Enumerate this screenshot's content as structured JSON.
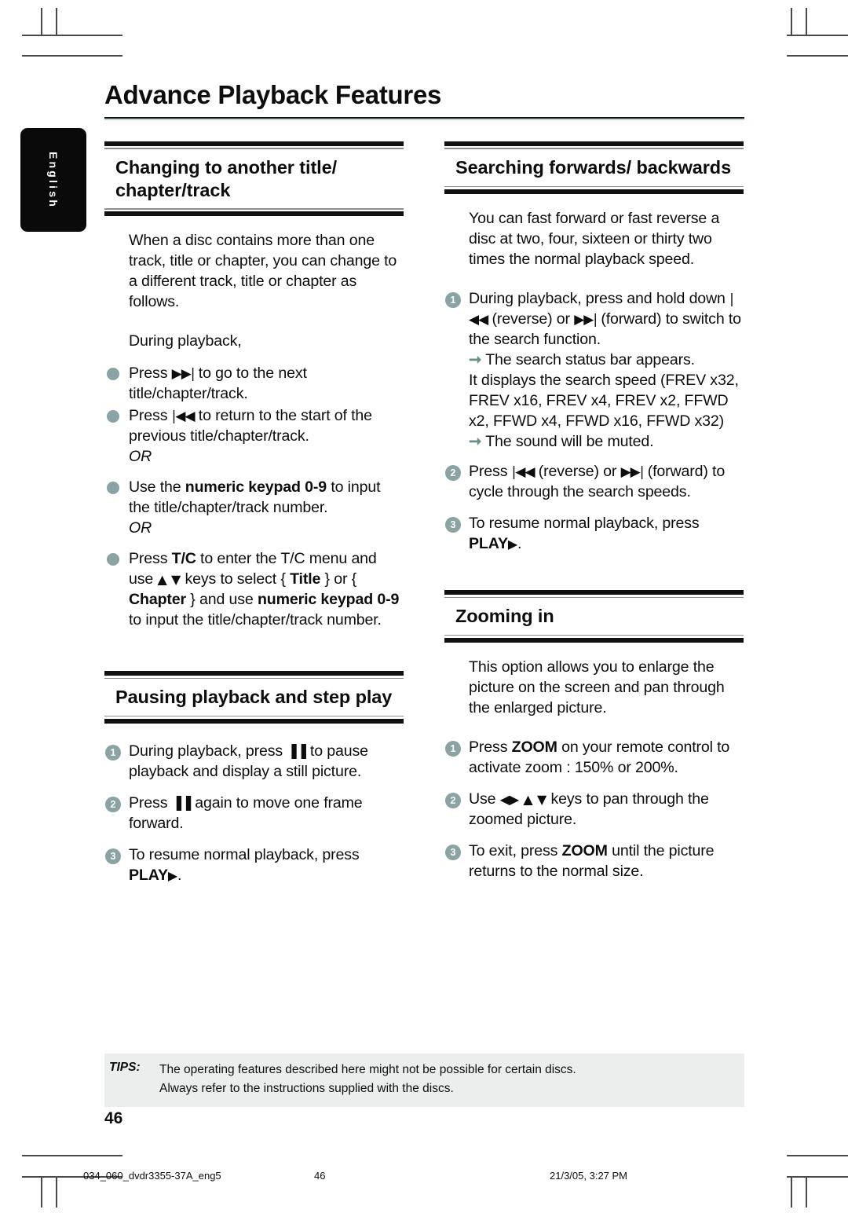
{
  "page_title": "Advance Playback Features",
  "language_tab": "English",
  "left_column": {
    "section1": {
      "heading": "Changing to another title/ chapter/track",
      "intro": "When a disc contains more than one track, title or chapter, you can change to a different track, title or chapter as follows.",
      "lead": "During playback,",
      "bullets": [
        {
          "text_before": "Press ",
          "glyph": "▶▶|",
          "text_after": " to go to the next title/chapter/track."
        },
        {
          "text_before": "Press ",
          "glyph": "|◀◀",
          "text_after": " to return to the start of the previous title/chapter/track.",
          "or": "OR"
        },
        {
          "text_before": "Use the ",
          "bold": "numeric keypad 0-9",
          "text_after": " to input the title/chapter/track number.",
          "or": "OR"
        }
      ],
      "last_bullet": {
        "p1": "Press ",
        "b1": "T/C",
        "p2": " to enter the T/C menu and use ",
        "keys": "▲ ▼",
        "p3": " keys to select { ",
        "b2": "Title",
        "p4": " } or { ",
        "b3": "Chapter",
        "p5": " } and use ",
        "b4": "numeric keypad 0-9",
        "p6": " to input the title/chapter/track number."
      }
    },
    "section2": {
      "heading": "Pausing playback and step play",
      "steps": [
        {
          "num": "1",
          "p1": "During playback, press ",
          "glyph": "▐▐",
          "p2": " to pause playback and display a still picture."
        },
        {
          "num": "2",
          "p1": "Press ",
          "glyph": "▐▐",
          "p2": " again to move one frame forward."
        },
        {
          "num": "3",
          "p1": "To resume normal playback, press ",
          "bold": "PLAY",
          "glyph2": "▶",
          "p2": "."
        }
      ]
    }
  },
  "right_column": {
    "section1": {
      "heading": "Searching forwards/ backwards",
      "intro": "You can fast forward or fast reverse a disc at two, four, sixteen or thirty two times the normal playback speed.",
      "steps": [
        {
          "num": "1",
          "p1": "During playback, press and hold down ",
          "glyph1": "|◀◀",
          "p2": " (reverse) or ",
          "glyph2": "▶▶|",
          "p3": " (forward) to switch to the search function.",
          "result1": "The search status bar appears.",
          "result1_cont": "It displays the search speed (FREV x32, FREV x16, FREV x4, FREV x2,  FFWD x2, FFWD x4, FFWD x16, FFWD x32)",
          "result2": "The sound will be muted."
        },
        {
          "num": "2",
          "p1": "Press  ",
          "glyph1": "|◀◀",
          "p2": " (reverse) or ",
          "glyph2": "▶▶|",
          "p3": " (forward) to cycle through the search speeds."
        },
        {
          "num": "3",
          "p1": "To resume normal playback, press ",
          "bold": "PLAY",
          "glyph1": "▶",
          "p2": "."
        }
      ]
    },
    "section2": {
      "heading": "Zooming in",
      "intro": "This option allows you to enlarge the picture on the screen and pan through the enlarged picture.",
      "steps": [
        {
          "num": "1",
          "p1": "Press ",
          "bold": "ZOOM",
          "p2": " on your remote control to activate zoom : 150% or 200%."
        },
        {
          "num": "2",
          "p1": "Use ",
          "keys": "◀▶ ▲ ▼",
          "p2": " keys to pan through the zoomed picture."
        },
        {
          "num": "3",
          "p1": "To exit, press ",
          "bold": "ZOOM",
          "p2": " until the picture returns to the normal size."
        }
      ]
    }
  },
  "tips": {
    "label": "TIPS:",
    "line1": "The operating features described here might not be possible for certain discs.",
    "line2": "Always refer to the instructions supplied with the discs."
  },
  "page_number": "46",
  "footer": {
    "file": "034_060_dvdr3355-37A_eng5",
    "page": "46",
    "datetime": "21/3/05, 3:27 PM"
  },
  "colors": {
    "accent": "#8ba3a3",
    "arrow": "#6d8c8c",
    "rule": "#111111",
    "tips_bg": "#eceeee"
  }
}
